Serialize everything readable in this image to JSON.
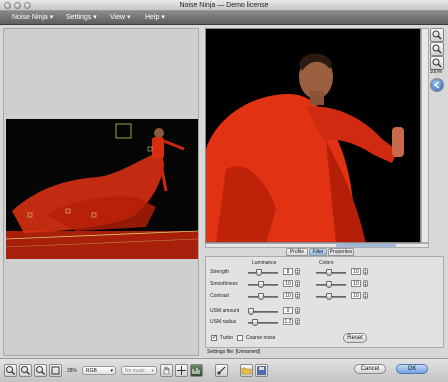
{
  "window": {
    "title": "Noise Ninja — Demo license"
  },
  "menubar": {
    "items": [
      {
        "label": "Noise Ninja ▾"
      },
      {
        "label": "Settings ▾"
      },
      {
        "label": "View ▾"
      },
      {
        "label": "Help ▾"
      }
    ]
  },
  "tools": {
    "zoom_level": "100%"
  },
  "tabs": [
    {
      "label": "Profile"
    },
    {
      "label": "Filter"
    },
    {
      "label": "Properties"
    }
  ],
  "filter": {
    "luminance_header": "Luminance",
    "colors_header": "Colors",
    "rows": [
      {
        "label": "Strength",
        "lum_value": "8",
        "color_value": "10"
      },
      {
        "label": "Smoothness",
        "lum_value": "10",
        "color_value": "10"
      },
      {
        "label": "Contrast",
        "lum_value": "10",
        "color_value": "10"
      }
    ],
    "usm_amount_label": "USM amount",
    "usm_amount_value": "0",
    "usm_radius_label": "USM radius",
    "usm_radius_value": "1.2",
    "turbo_label": "Turbo",
    "coarse_label": "Coarse noise",
    "reset_label": "Reset"
  },
  "settings_file": "Settings file: [Unnamed]",
  "bottom": {
    "zoom": "28%",
    "channel": "RGB",
    "mask": "No mask",
    "cancel_label": "Cancel",
    "ok_label": "OK"
  },
  "colors": {
    "accent": "#6fa0e0",
    "photo_red": "#e23214"
  }
}
